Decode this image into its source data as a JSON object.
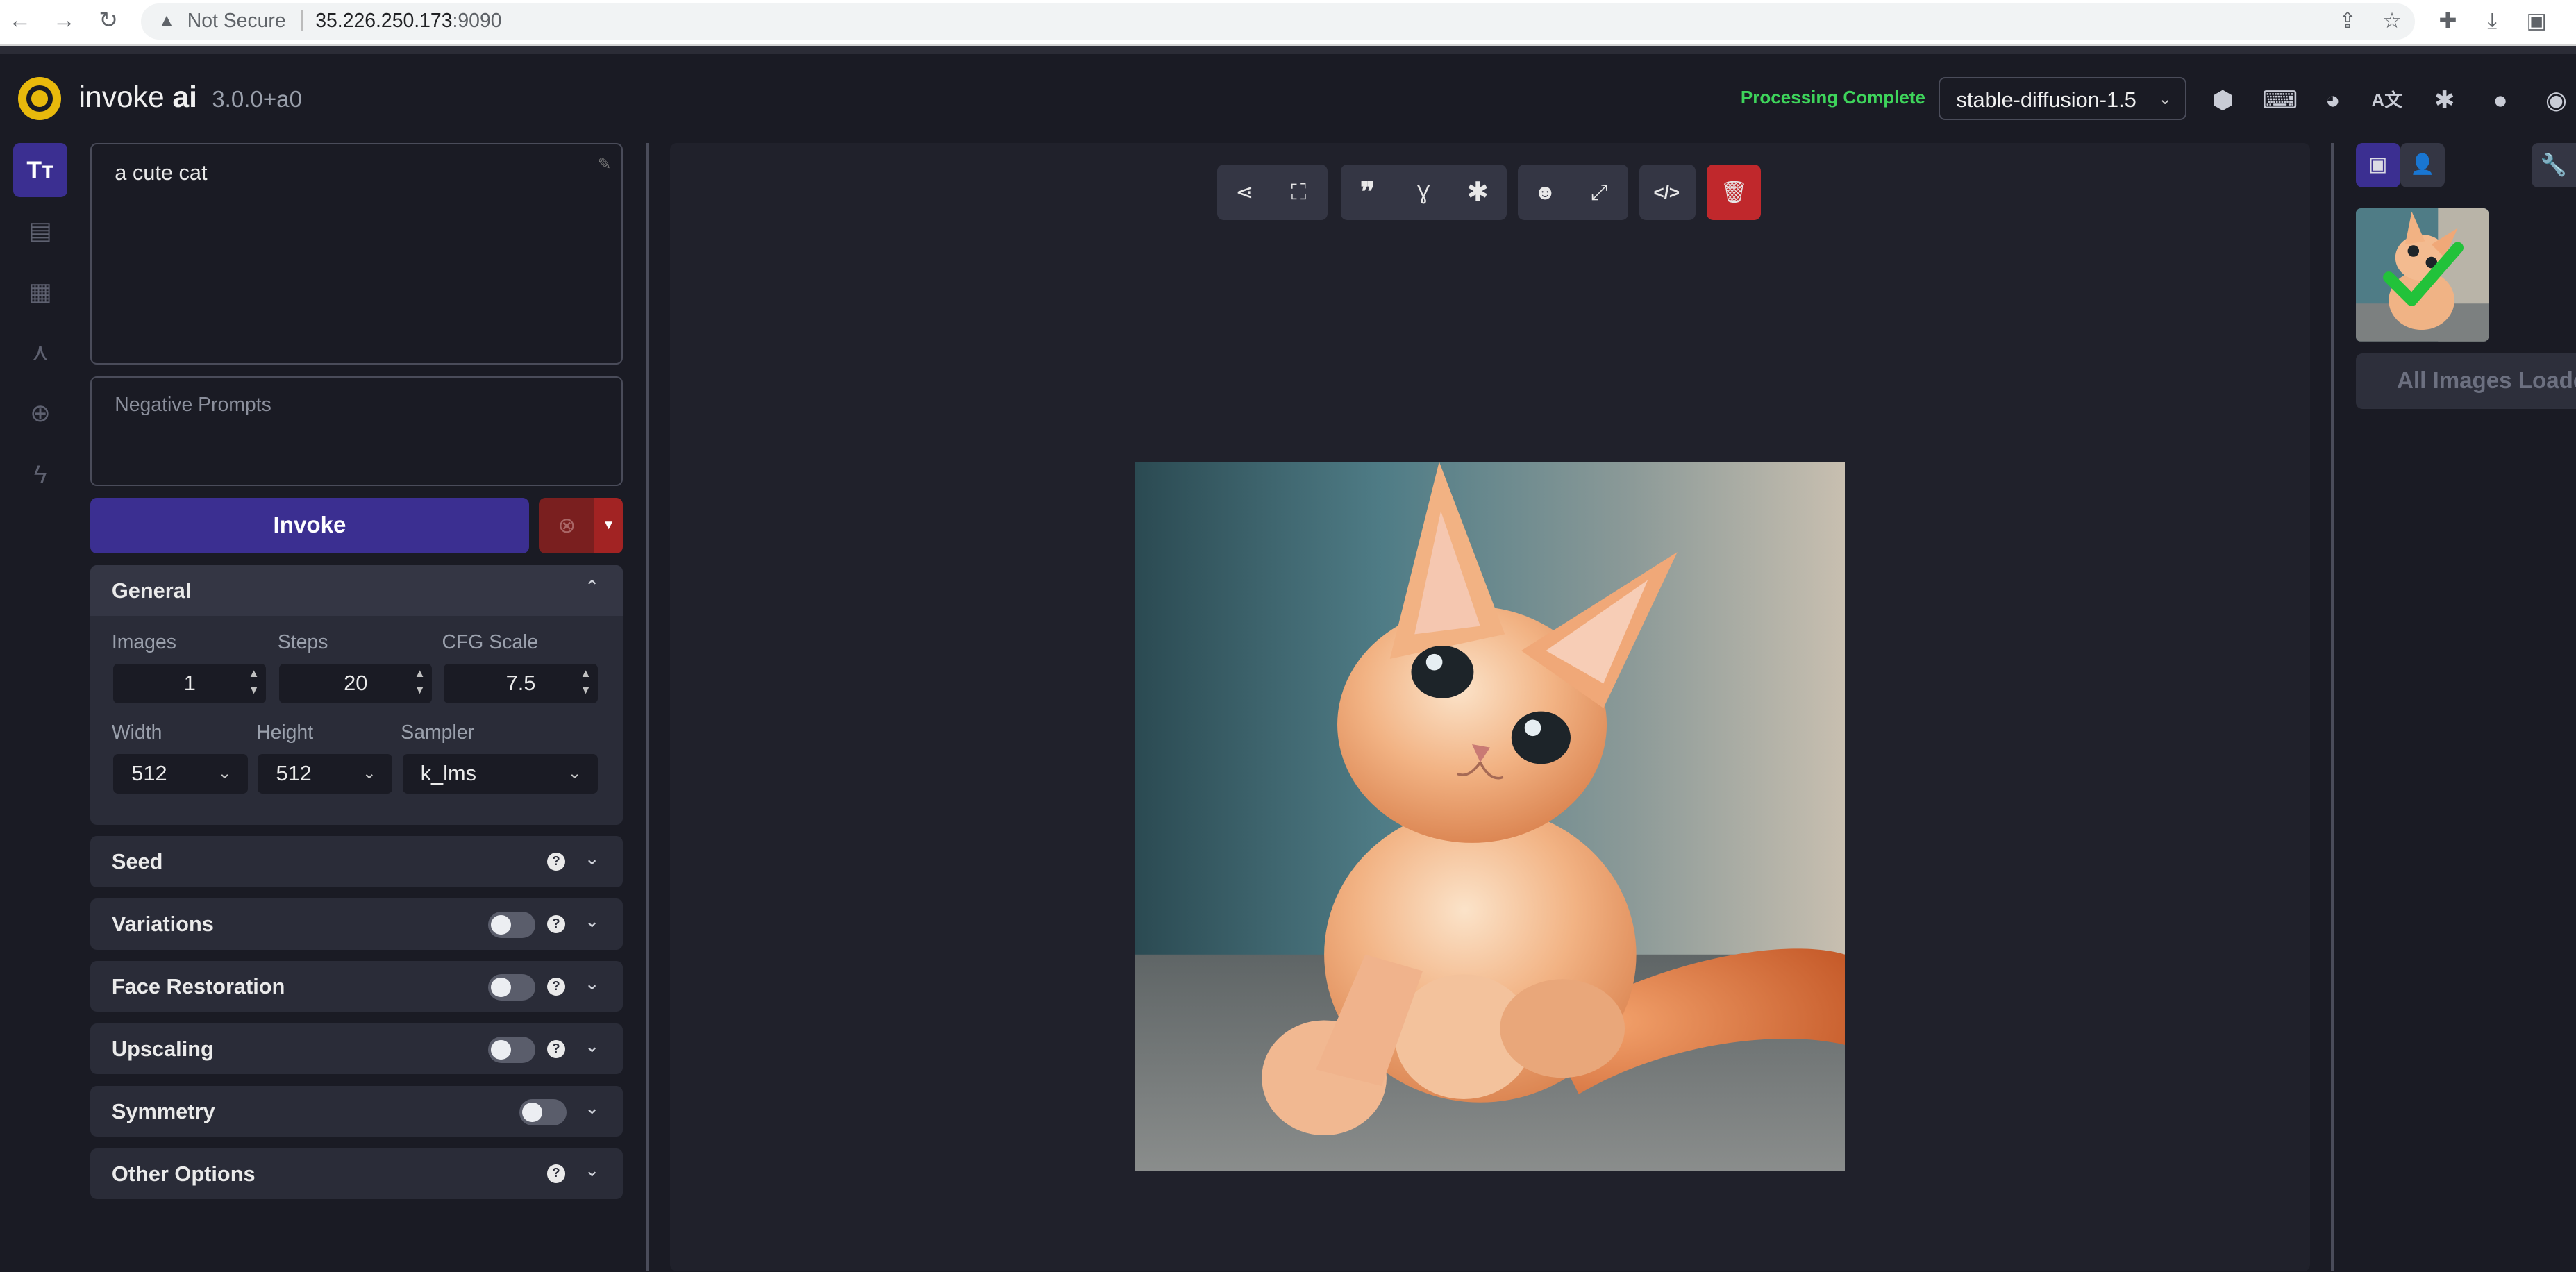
{
  "browser": {
    "back": "←",
    "forward": "→",
    "reload": "↻",
    "security_label": "Not Secure",
    "url_host": "35.226.250.173",
    "url_port": ":9090"
  },
  "header": {
    "brand_main": "invoke",
    "brand_bold": "ai",
    "version": "3.0.0+a0",
    "status": "Processing Complete",
    "model": "stable-diffusion-1.5",
    "status_color": "#3ed45b"
  },
  "prompt": {
    "value": "a cute cat",
    "negative_placeholder": "Negative Prompts"
  },
  "actions": {
    "invoke_label": "Invoke"
  },
  "general": {
    "title": "General",
    "images_label": "Images",
    "images_value": "1",
    "steps_label": "Steps",
    "steps_value": "20",
    "cfg_label": "CFG Scale",
    "cfg_value": "7.5",
    "width_label": "Width",
    "width_value": "512",
    "height_label": "Height",
    "height_value": "512",
    "sampler_label": "Sampler",
    "sampler_value": "k_lms"
  },
  "sections": {
    "seed": "Seed",
    "variations": "Variations",
    "face_restoration": "Face Restoration",
    "upscaling": "Upscaling",
    "symmetry": "Symmetry",
    "other_options": "Other Options"
  },
  "gallery": {
    "all_loaded": "All Images Loaded"
  },
  "colors": {
    "accent": "#3b2f91",
    "danger": "#c0282c",
    "background": "#1a1b24",
    "panel": "#2a2c38"
  }
}
